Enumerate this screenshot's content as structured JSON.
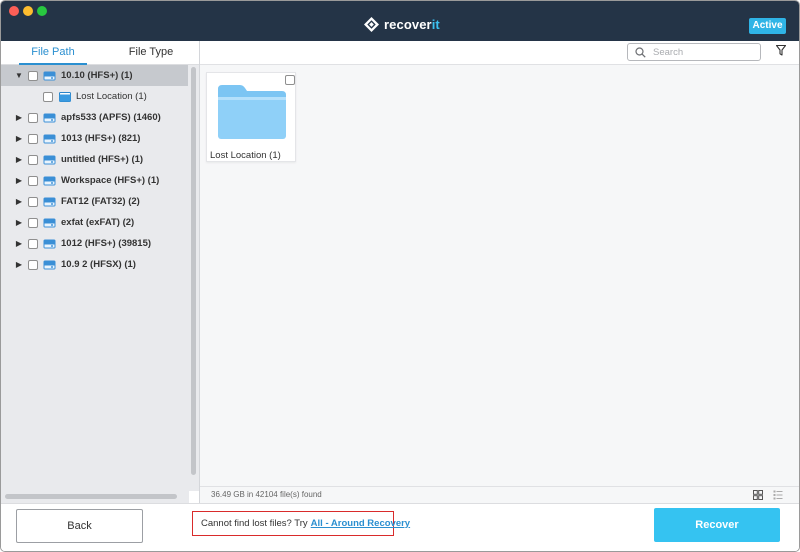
{
  "app": {
    "brand_prefix": "recover",
    "brand_suffix": "it",
    "status_badge": "Active"
  },
  "sidebar": {
    "tabs": [
      {
        "label": "File Path",
        "selected": true
      },
      {
        "label": "File Type",
        "selected": false
      }
    ],
    "tree": [
      {
        "label": "10.10 (HFS+) (1)",
        "expanded": true,
        "selected": true,
        "icon": "drive-icon"
      },
      {
        "label": "Lost Location (1)",
        "child": true,
        "icon": "folder-icon"
      },
      {
        "label": "apfs533 (APFS) (1460)",
        "icon": "drive-icon"
      },
      {
        "label": "1013 (HFS+) (821)",
        "icon": "drive-icon"
      },
      {
        "label": "untitled (HFS+) (1)",
        "icon": "drive-icon"
      },
      {
        "label": "Workspace (HFS+) (1)",
        "icon": "drive-icon"
      },
      {
        "label": "FAT12 (FAT32) (2)",
        "icon": "drive-icon"
      },
      {
        "label": "exfat (exFAT) (2)",
        "icon": "drive-icon"
      },
      {
        "label": "1012 (HFS+) (39815)",
        "icon": "drive-icon"
      },
      {
        "label": "10.9 2 (HFSX) (1)",
        "icon": "drive-icon"
      }
    ]
  },
  "main": {
    "search": {
      "placeholder": "Search",
      "value": ""
    },
    "files": [
      {
        "label": "Lost Location (1)",
        "icon": "folder-icon"
      }
    ],
    "status": "36.49 GB in 42104 file(s) found"
  },
  "footer": {
    "back_label": "Back",
    "hint_text": "Cannot find lost files? Try",
    "hint_link": "All - Around Recovery",
    "recover_label": "Recover"
  },
  "colors": {
    "titlebar": "#243447",
    "accent": "#35c3f1",
    "link": "#2a8fd0",
    "hint_border": "#d92b2b"
  }
}
